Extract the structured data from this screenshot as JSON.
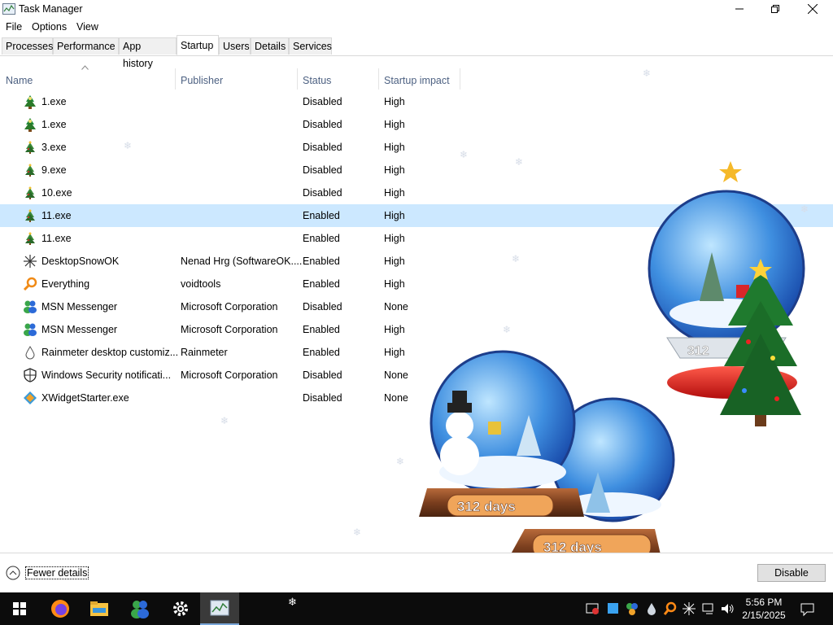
{
  "window": {
    "title": "Task Manager",
    "controls": {
      "minimize": "–",
      "maximize": "❐",
      "close": "✕"
    }
  },
  "menu": [
    "File",
    "Options",
    "View"
  ],
  "tabs": [
    "Processes",
    "Performance",
    "App history",
    "Startup",
    "Users",
    "Details",
    "Services"
  ],
  "active_tab": "Startup",
  "columns": {
    "name": "Name",
    "publisher": "Publisher",
    "status": "Status",
    "impact": "Startup impact"
  },
  "rows": [
    {
      "name": "1.exe",
      "publisher": "",
      "status": "Disabled",
      "impact": "High",
      "icon": "tree-green-icon"
    },
    {
      "name": "1.exe",
      "publisher": "",
      "status": "Disabled",
      "impact": "High",
      "icon": "tree-green-icon"
    },
    {
      "name": "3.exe",
      "publisher": "",
      "status": "Disabled",
      "impact": "High",
      "icon": "tree-small-icon"
    },
    {
      "name": "9.exe",
      "publisher": "",
      "status": "Disabled",
      "impact": "High",
      "icon": "tree-small-icon"
    },
    {
      "name": "10.exe",
      "publisher": "",
      "status": "Disabled",
      "impact": "High",
      "icon": "tree-small-icon"
    },
    {
      "name": "11.exe",
      "publisher": "",
      "status": "Enabled",
      "impact": "High",
      "icon": "tree-small-icon",
      "selected": true
    },
    {
      "name": "11.exe",
      "publisher": "",
      "status": "Enabled",
      "impact": "High",
      "icon": "tree-small-icon"
    },
    {
      "name": "DesktopSnowOK",
      "publisher": "Nenad Hrg (SoftwareOK....",
      "status": "Enabled",
      "impact": "High",
      "icon": "snowflake-icon"
    },
    {
      "name": "Everything",
      "publisher": "voidtools",
      "status": "Enabled",
      "impact": "High",
      "icon": "magnifier-icon"
    },
    {
      "name": "MSN Messenger",
      "publisher": "Microsoft Corporation",
      "status": "Disabled",
      "impact": "None",
      "icon": "msn-buddy-icon"
    },
    {
      "name": "MSN Messenger",
      "publisher": "Microsoft Corporation",
      "status": "Enabled",
      "impact": "High",
      "icon": "msn-buddy-icon"
    },
    {
      "name": "Rainmeter desktop customiz...",
      "publisher": "Rainmeter",
      "status": "Enabled",
      "impact": "High",
      "icon": "raindrop-icon"
    },
    {
      "name": "Windows Security notificati...",
      "publisher": "Microsoft Corporation",
      "status": "Disabled",
      "impact": "None",
      "icon": "shield-icon"
    },
    {
      "name": "XWidgetStarter.exe",
      "publisher": "",
      "status": "Disabled",
      "impact": "None",
      "icon": "xwidget-icon"
    }
  ],
  "bottom": {
    "fewer_details": "Fewer details",
    "disable": "Disable"
  },
  "globes": {
    "label_left": "312 days",
    "label_right": "312 days",
    "label_top": "312"
  },
  "taskbar": {
    "apps": [
      "windows-start-icon",
      "firefox-icon",
      "file-explorer-icon",
      "msn-buddy-icon",
      "settings-gear-icon",
      "task-manager-icon"
    ],
    "time": "5:56 PM",
    "date": "2/15/2025"
  },
  "colors": {
    "selection": "#cce8ff",
    "header_text": "#4d6182",
    "taskbar": "#0c0c0c"
  }
}
